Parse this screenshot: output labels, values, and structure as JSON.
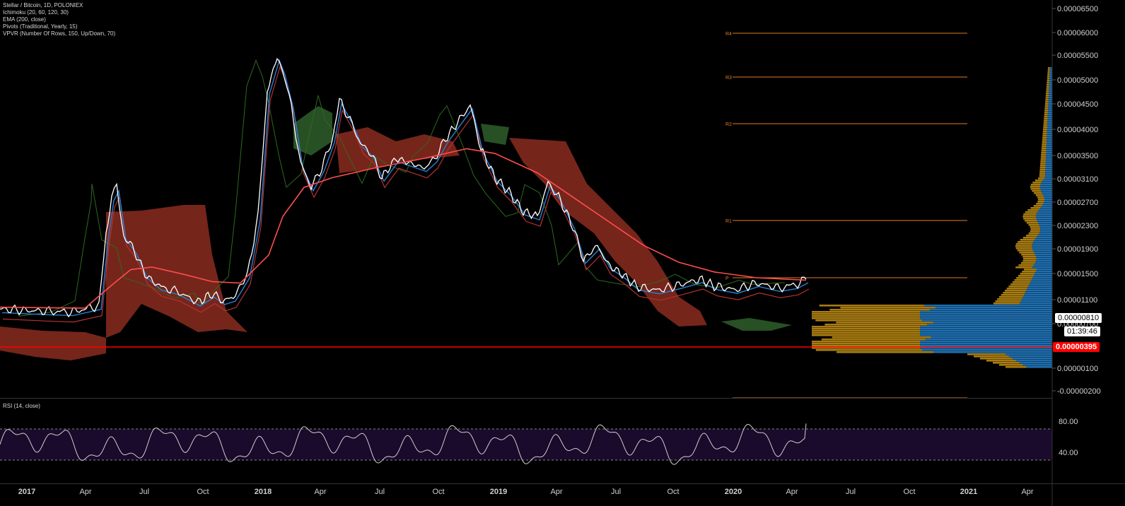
{
  "legend": {
    "title": "Stellar / Bitcoin, 1D, POLONIEX",
    "indicators": [
      "Ichimoku (20, 60, 120, 30)",
      "EMA (200, close)",
      "Pivots (Traditional, Yearly, 15)",
      "VPVR (Number Of Rows, 150, Up/Down, 70)"
    ],
    "rsi_title": "RSI (14, close)"
  },
  "colors": {
    "price": "#ffffff",
    "ema": "#ff4d4d",
    "tenkan": "#2a7fd4",
    "kijun": "#b53232",
    "chikou": "#2d6a1e",
    "cloud_bear": "#8b2b20",
    "cloud_bull": "#2f5e2b",
    "pivot": "#e07b20",
    "hline": "#ff0000",
    "rsi": "#cfcfcf",
    "rsi_band": "#1a0a2b",
    "vpvr_up": "#1f6fb0",
    "vpvr_down": "#a87c12"
  },
  "price_tags": {
    "last": "0.00000810",
    "timer": "01:39:46",
    "hline": "0.00000395"
  },
  "chart_data": {
    "type": "line",
    "price_axis_ticks": [
      "0.00006500",
      "0.00006000",
      "0.00005500",
      "0.00005000",
      "0.00004500",
      "0.00004000",
      "0.00003500",
      "0.00003100",
      "0.00002700",
      "0.00002300",
      "0.00001900",
      "0.00001500",
      "0.00001100",
      "0.00000700",
      "0.00000300",
      "0.00000100",
      "-0.00000200"
    ],
    "time_axis_ticks": [
      "2017",
      "Apr",
      "Jul",
      "Oct",
      "2018",
      "Apr",
      "Jul",
      "Oct",
      "2019",
      "Apr",
      "Jul",
      "Oct",
      "2020",
      "Apr",
      "Jul",
      "Oct",
      "2021",
      "Apr"
    ],
    "rsi_axis_ticks": [
      "80.00",
      "40.00"
    ],
    "pivots": [
      {
        "label": "R4",
        "value": 6e-05
      },
      {
        "label": "R3",
        "value": 5.05e-05
      },
      {
        "label": "R2",
        "value": 4.11e-05
      },
      {
        "label": "R1",
        "value": 2.37e-05
      },
      {
        "label": "P",
        "value": 1.43e-05
      }
    ],
    "hline_value": 3.95e-06,
    "series": [
      {
        "name": "price",
        "points": [
          [
            0,
            2.8e-06
          ],
          [
            60,
            2.4e-06
          ],
          [
            100,
            2.2e-06
          ],
          [
            140,
            3.5e-06
          ],
          [
            150,
            1.8e-05
          ],
          [
            158,
            2.6e-05
          ],
          [
            165,
            2.8e-05
          ],
          [
            175,
            1.8e-05
          ],
          [
            190,
            1.5e-05
          ],
          [
            205,
            1e-05
          ],
          [
            225,
            7.5e-06
          ],
          [
            250,
            6.5e-06
          ],
          [
            280,
            4.2e-06
          ],
          [
            300,
            6e-06
          ],
          [
            315,
            4.5e-06
          ],
          [
            330,
            5.2e-06
          ],
          [
            350,
            1e-05
          ],
          [
            365,
            2.2e-05
          ],
          [
            378,
            4.8e-05
          ],
          [
            392,
            5.5e-05
          ],
          [
            400,
            5.2e-05
          ],
          [
            412,
            4.5e-05
          ],
          [
            425,
            3.3e-05
          ],
          [
            440,
            2.8e-05
          ],
          [
            455,
            3.2e-05
          ],
          [
            470,
            3.8e-05
          ],
          [
            480,
            4.6e-05
          ],
          [
            495,
            4.2e-05
          ],
          [
            510,
            3.7e-05
          ],
          [
            525,
            3.5e-05
          ],
          [
            540,
            3e-05
          ],
          [
            560,
            3.4e-05
          ],
          [
            580,
            3.3e-05
          ],
          [
            600,
            3.2e-05
          ],
          [
            615,
            3.4e-05
          ],
          [
            630,
            3.8e-05
          ],
          [
            650,
            4.2e-05
          ],
          [
            665,
            4.5e-05
          ],
          [
            680,
            3.6e-05
          ],
          [
            700,
            3e-05
          ],
          [
            720,
            2.7e-05
          ],
          [
            740,
            2.3e-05
          ],
          [
            760,
            2.2e-05
          ],
          [
            775,
            2.9e-05
          ],
          [
            790,
            2.6e-05
          ],
          [
            810,
            2e-05
          ],
          [
            825,
            1.3e-05
          ],
          [
            845,
            1.6e-05
          ],
          [
            860,
            1.2e-05
          ],
          [
            880,
            1e-05
          ],
          [
            900,
            7.5e-06
          ],
          [
            930,
            6.7e-06
          ],
          [
            960,
            7.8e-06
          ],
          [
            990,
            9e-06
          ],
          [
            1010,
            7.6e-06
          ],
          [
            1040,
            6.8e-06
          ],
          [
            1070,
            8.2e-06
          ],
          [
            1100,
            7.2e-06
          ],
          [
            1125,
            7.8e-06
          ],
          [
            1140,
            9e-06
          ]
        ]
      },
      {
        "name": "ema",
        "points": [
          [
            0,
            3.2e-06
          ],
          [
            120,
            3e-06
          ],
          [
            160,
            8e-06
          ],
          [
            185,
            1.1e-05
          ],
          [
            215,
            1.15e-05
          ],
          [
            260,
            1e-05
          ],
          [
            300,
            8.5e-06
          ],
          [
            340,
            8.2e-06
          ],
          [
            380,
            1.4e-05
          ],
          [
            400,
            2.2e-05
          ],
          [
            430,
            2.8e-05
          ],
          [
            470,
            3e-05
          ],
          [
            530,
            3.2e-05
          ],
          [
            600,
            3.4e-05
          ],
          [
            660,
            3.6e-05
          ],
          [
            700,
            3.5e-05
          ],
          [
            760,
            3.1e-05
          ],
          [
            810,
            2.6e-05
          ],
          [
            860,
            2.1e-05
          ],
          [
            910,
            1.6e-05
          ],
          [
            960,
            1.25e-05
          ],
          [
            1010,
            1.05e-05
          ],
          [
            1070,
            9.3e-06
          ],
          [
            1140,
            8.8e-06
          ]
        ]
      }
    ],
    "rsi": {
      "upper": 70,
      "lower": 30,
      "last": 77
    }
  }
}
